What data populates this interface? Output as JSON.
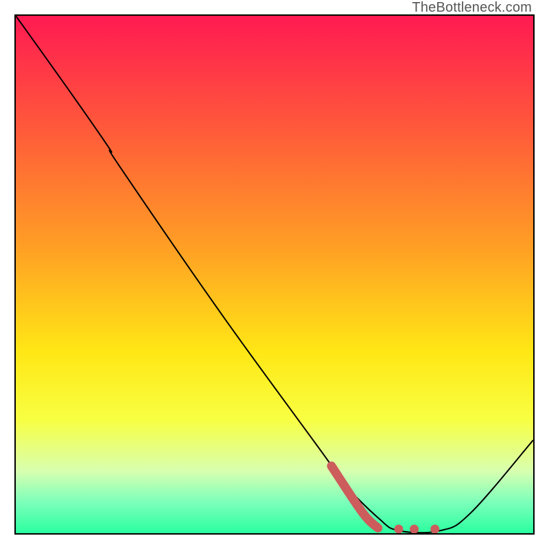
{
  "watermark": "TheBottleneck.com",
  "chart_data": {
    "type": "line",
    "title": "",
    "xlabel": "",
    "ylabel": "",
    "xlim": [
      0,
      100
    ],
    "ylim": [
      0,
      100
    ],
    "grid": false,
    "legend": false,
    "gradient_stops": [
      {
        "offset": 0,
        "color": "#ff1a52"
      },
      {
        "offset": 22,
        "color": "#ff5a3a"
      },
      {
        "offset": 45,
        "color": "#ffa024"
      },
      {
        "offset": 65,
        "color": "#ffe715"
      },
      {
        "offset": 78,
        "color": "#f8ff42"
      },
      {
        "offset": 88,
        "color": "#d8ffb0"
      },
      {
        "offset": 94,
        "color": "#7cffba"
      },
      {
        "offset": 100,
        "color": "#2aff9f"
      }
    ],
    "series": [
      {
        "name": "bottleneck-curve",
        "color": "#000000",
        "width": 2,
        "points": [
          {
            "x": 0,
            "y": 100
          },
          {
            "x": 10,
            "y": 86
          },
          {
            "x": 18,
            "y": 74.5
          },
          {
            "x": 20,
            "y": 71
          },
          {
            "x": 40,
            "y": 42
          },
          {
            "x": 60,
            "y": 14.5
          },
          {
            "x": 63,
            "y": 10
          },
          {
            "x": 70,
            "y": 3
          },
          {
            "x": 74,
            "y": 0.5
          },
          {
            "x": 82,
            "y": 0.5
          },
          {
            "x": 88,
            "y": 4
          },
          {
            "x": 100,
            "y": 18
          }
        ]
      },
      {
        "name": "highlight-segment",
        "color": "#cd5c5c",
        "width": 13,
        "rounded": true,
        "points": [
          {
            "x": 61,
            "y": 13
          },
          {
            "x": 67,
            "y": 4
          },
          {
            "x": 70,
            "y": 1
          }
        ]
      }
    ],
    "dots": {
      "series_ref": "highlight-dots",
      "color": "#cd5c5c",
      "radius": 6.5,
      "points": [
        {
          "x": 74,
          "y": 0.8
        },
        {
          "x": 77,
          "y": 0.8
        },
        {
          "x": 81,
          "y": 0.8
        }
      ]
    }
  }
}
